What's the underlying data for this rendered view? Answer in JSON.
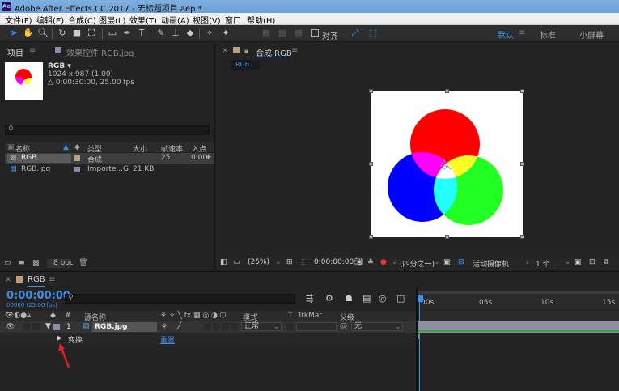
{
  "titlebar": {
    "title": "Adobe After Effects CC 2017 - 无标题项目.aep *",
    "logo": "Ae"
  },
  "menu": [
    "文件(F)",
    "编辑(E)",
    "合成(C)",
    "图层(L)",
    "效果(T)",
    "动画(A)",
    "视图(V)",
    "窗口",
    "帮助(H)"
  ],
  "toolbar": {
    "align_label": "对齐",
    "workspaces": [
      "默认",
      "标准",
      "小屏幕"
    ],
    "active_workspace": "默认"
  },
  "project": {
    "tab_label": "项目",
    "effects_tab": "效果控件 RGB.jpg",
    "selected": {
      "name": "RGB ▾",
      "dims": "1024 x 987 (1.00)",
      "duration": "△ 0:00:30:00, 25.00 fps"
    },
    "columns": [
      "名称",
      "类型",
      "大小",
      "帧速率",
      "入点"
    ],
    "items": [
      {
        "name": "RGB",
        "type": "合成",
        "size": "",
        "fps": "25",
        "in": "0:00"
      },
      {
        "name": "RGB.jpg",
        "type": "Importe...G",
        "size": "21 KB",
        "fps": "",
        "in": ""
      }
    ],
    "bpc": "8 bpc"
  },
  "comp": {
    "tab_label": "合成 RGB",
    "breadcrumb": "RGB",
    "zoom": "(25%)",
    "timecode": "0:00:00:00",
    "resolution": "(四分之一)",
    "camera": "活动摄像机",
    "views": "1 个..."
  },
  "timeline": {
    "tab_label": "RGB",
    "timecode": "0:00:00:00",
    "fps": "00000 (25.00 fps)",
    "columns": [
      "源名称",
      "模式",
      "T",
      "TrkMat",
      "父级"
    ],
    "layer": {
      "num": "1",
      "name": "RGB.jpg",
      "mode": "正常",
      "parent": "无"
    },
    "transform_label": "变换",
    "reset_label": "重置",
    "ruler": [
      "00s",
      "05s",
      "10s",
      "15s"
    ]
  },
  "colors": {
    "accent": "#3b8de6",
    "red": "#ff0000",
    "green": "#22ff22",
    "blue": "#0000ff"
  }
}
